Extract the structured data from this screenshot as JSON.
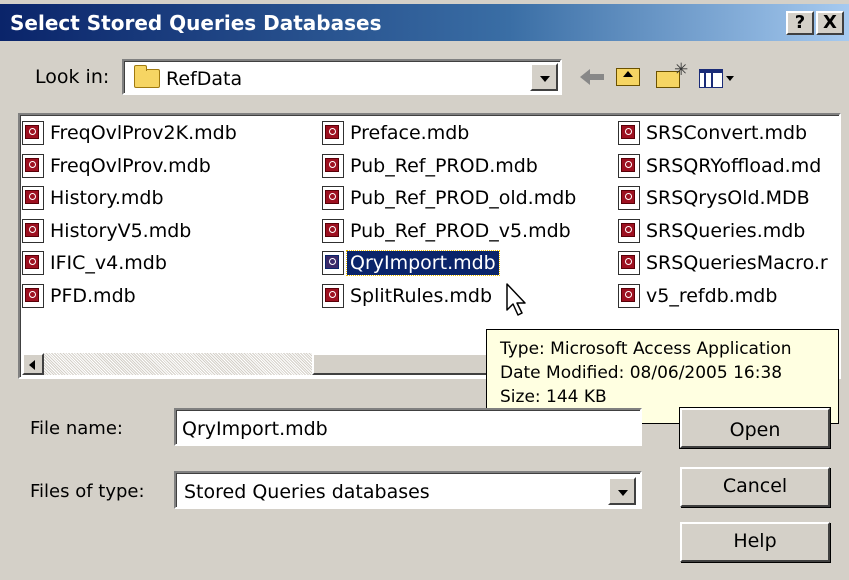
{
  "window": {
    "title": "Select Stored Queries Databases",
    "help_btn": "?",
    "close_btn": "X"
  },
  "toolbar": {
    "look_in_label": "Look in:",
    "look_in_value": "RefData"
  },
  "files": {
    "col0": [
      "FreqOvlProv2K.mdb",
      "FreqOvlProv.mdb",
      "History.mdb",
      "HistoryV5.mdb",
      "IFIC_v4.mdb",
      "PFD.mdb"
    ],
    "col1": [
      "Preface.mdb",
      "Pub_Ref_PROD.mdb",
      "Pub_Ref_PROD_old.mdb",
      "Pub_Ref_PROD_v5.mdb",
      "QryImport.mdb",
      "SplitRules.mdb"
    ],
    "col2": [
      "SRSConvert.mdb",
      "SRSQRYoffload.md",
      "SRSQrysOld.MDB",
      "SRSQueries.mdb",
      "SRSQueriesMacro.r",
      "v5_refdb.mdb"
    ]
  },
  "tooltip": {
    "type": "Type: Microsoft Access Application",
    "modified": "Date Modified: 08/06/2005 16:38",
    "size": "Size: 144 KB"
  },
  "form": {
    "file_name_label": "File name:",
    "file_name_value": "QryImport.mdb",
    "file_type_label": "Files of type:",
    "file_type_value": "Stored Queries databases"
  },
  "buttons": {
    "open": "Open",
    "cancel": "Cancel",
    "help": "Help"
  },
  "colors": {
    "titlebar_start": "#0a246a",
    "titlebar_end": "#a6caf0",
    "face": "#d4d0c8",
    "selection": "#0a246a",
    "tooltip_bg": "#ffffe1"
  },
  "icons": {
    "look_in": "folder-icon",
    "back": "back-arrow-icon",
    "up": "up-one-level-icon",
    "new_folder": "new-folder-icon",
    "view": "view-menu-icon",
    "file": "access-database-icon",
    "cursor": "pointer-cursor-icon"
  }
}
